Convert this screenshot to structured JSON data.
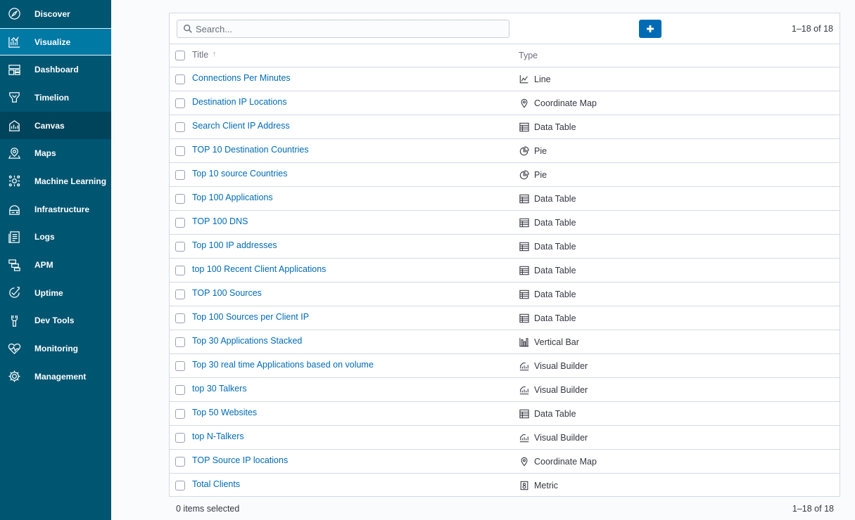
{
  "sidebar": {
    "items": [
      {
        "label": "Discover",
        "icon": "compass-icon"
      },
      {
        "label": "Visualize",
        "icon": "visualize-icon",
        "active": true
      },
      {
        "label": "Dashboard",
        "icon": "dashboard-icon"
      },
      {
        "label": "Timelion",
        "icon": "timelion-icon"
      },
      {
        "label": "Canvas",
        "icon": "canvas-icon",
        "hover": true
      },
      {
        "label": "Maps",
        "icon": "maps-icon"
      },
      {
        "label": "Machine Learning",
        "icon": "machine-learning-icon"
      },
      {
        "label": "Infrastructure",
        "icon": "infrastructure-icon"
      },
      {
        "label": "Logs",
        "icon": "logs-icon"
      },
      {
        "label": "APM",
        "icon": "apm-icon"
      },
      {
        "label": "Uptime",
        "icon": "uptime-icon"
      },
      {
        "label": "Dev Tools",
        "icon": "dev-tools-icon"
      },
      {
        "label": "Monitoring",
        "icon": "monitoring-icon"
      },
      {
        "label": "Management",
        "icon": "gear-icon"
      }
    ]
  },
  "toolbar": {
    "search_placeholder": "Search...",
    "search_value": "",
    "add_icon": "plus-icon",
    "pager": "1–18 of 18"
  },
  "table": {
    "columns": {
      "title": "Title",
      "type": "Type"
    },
    "sort_indicator": "↑",
    "rows": [
      {
        "title": "Connections Per Minutes",
        "type": "Line",
        "icon": "line-chart-icon"
      },
      {
        "title": "Destination IP Locations",
        "type": "Coordinate Map",
        "icon": "map-pin-icon"
      },
      {
        "title": "Search Client IP Address",
        "type": "Data Table",
        "icon": "table-icon"
      },
      {
        "title": "TOP 10 Destination Countries",
        "type": "Pie",
        "icon": "pie-chart-icon"
      },
      {
        "title": "Top 10 source Countries",
        "type": "Pie",
        "icon": "pie-chart-icon"
      },
      {
        "title": "Top 100 Applications",
        "type": "Data Table",
        "icon": "table-icon"
      },
      {
        "title": "TOP 100 DNS",
        "type": "Data Table",
        "icon": "table-icon"
      },
      {
        "title": "Top 100 IP addresses",
        "type": "Data Table",
        "icon": "table-icon"
      },
      {
        "title": "top 100 Recent Client Applications",
        "type": "Data Table",
        "icon": "table-icon"
      },
      {
        "title": "TOP 100 Sources",
        "type": "Data Table",
        "icon": "table-icon"
      },
      {
        "title": "Top 100 Sources per Client IP",
        "type": "Data Table",
        "icon": "table-icon"
      },
      {
        "title": "Top 30 Applications Stacked",
        "type": "Vertical Bar",
        "icon": "vertical-bar-icon"
      },
      {
        "title": "Top 30 real time Applications based on volume",
        "type": "Visual Builder",
        "icon": "visual-builder-icon"
      },
      {
        "title": "top 30 Talkers",
        "type": "Visual Builder",
        "icon": "visual-builder-icon"
      },
      {
        "title": "Top 50 Websites",
        "type": "Data Table",
        "icon": "table-icon"
      },
      {
        "title": "top N-Talkers",
        "type": "Visual Builder",
        "icon": "visual-builder-icon"
      },
      {
        "title": "TOP Source IP locations",
        "type": "Coordinate Map",
        "icon": "map-pin-icon"
      },
      {
        "title": "Total Clients",
        "type": "Metric",
        "icon": "metric-icon"
      }
    ]
  },
  "footer": {
    "selected": "0 items selected",
    "pager": "1–18 of 18"
  },
  "colors": {
    "sidebar_bg": "#005571",
    "sidebar_active": "#0079a5",
    "link": "#006bb4",
    "primary_button": "#006bb4"
  }
}
